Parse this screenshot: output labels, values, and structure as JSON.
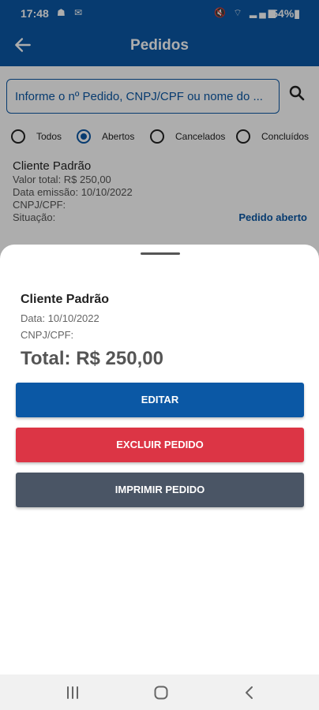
{
  "status_bar": {
    "time": "17:48",
    "left_icons": "☗ ✉",
    "right_icons": "🔇 ⌔ ▂▄▆",
    "battery": "54%▮"
  },
  "app_bar": {
    "title": "Pedidos",
    "back_icon": "arrow-left-icon"
  },
  "search": {
    "placeholder": "Informe o nº Pedido, CNPJ/CPF ou nome do ...",
    "icon": "search-icon"
  },
  "filters": {
    "options": [
      "Todos",
      "Abertos",
      "Cancelados",
      "Concluídos"
    ],
    "selected": "Abertos"
  },
  "order": {
    "client": "Cliente Padrão",
    "total": "Valor total: R$ 250,00",
    "emission": "Data emissão: 10/10/2022",
    "cnpj": "CNPJ/CPF:",
    "situation": "Situação:",
    "status": "Pedido aberto"
  },
  "sheet": {
    "client": "Cliente Padrão",
    "date": "Data: 10/10/2022",
    "cnpj": "CNPJ/CPF:",
    "total": "Total: R$ 250,00",
    "buttons": {
      "edit": "EDITAR",
      "delete": "EXCLUIR PEDIDO",
      "print": "IMPRIMIR PEDIDO"
    }
  },
  "colors": {
    "primary": "#0b58a5",
    "danger": "#dc3545",
    "secondary": "#4a5565"
  },
  "nav": {
    "icons": [
      "recent-apps-icon",
      "home-icon",
      "back-icon"
    ]
  }
}
